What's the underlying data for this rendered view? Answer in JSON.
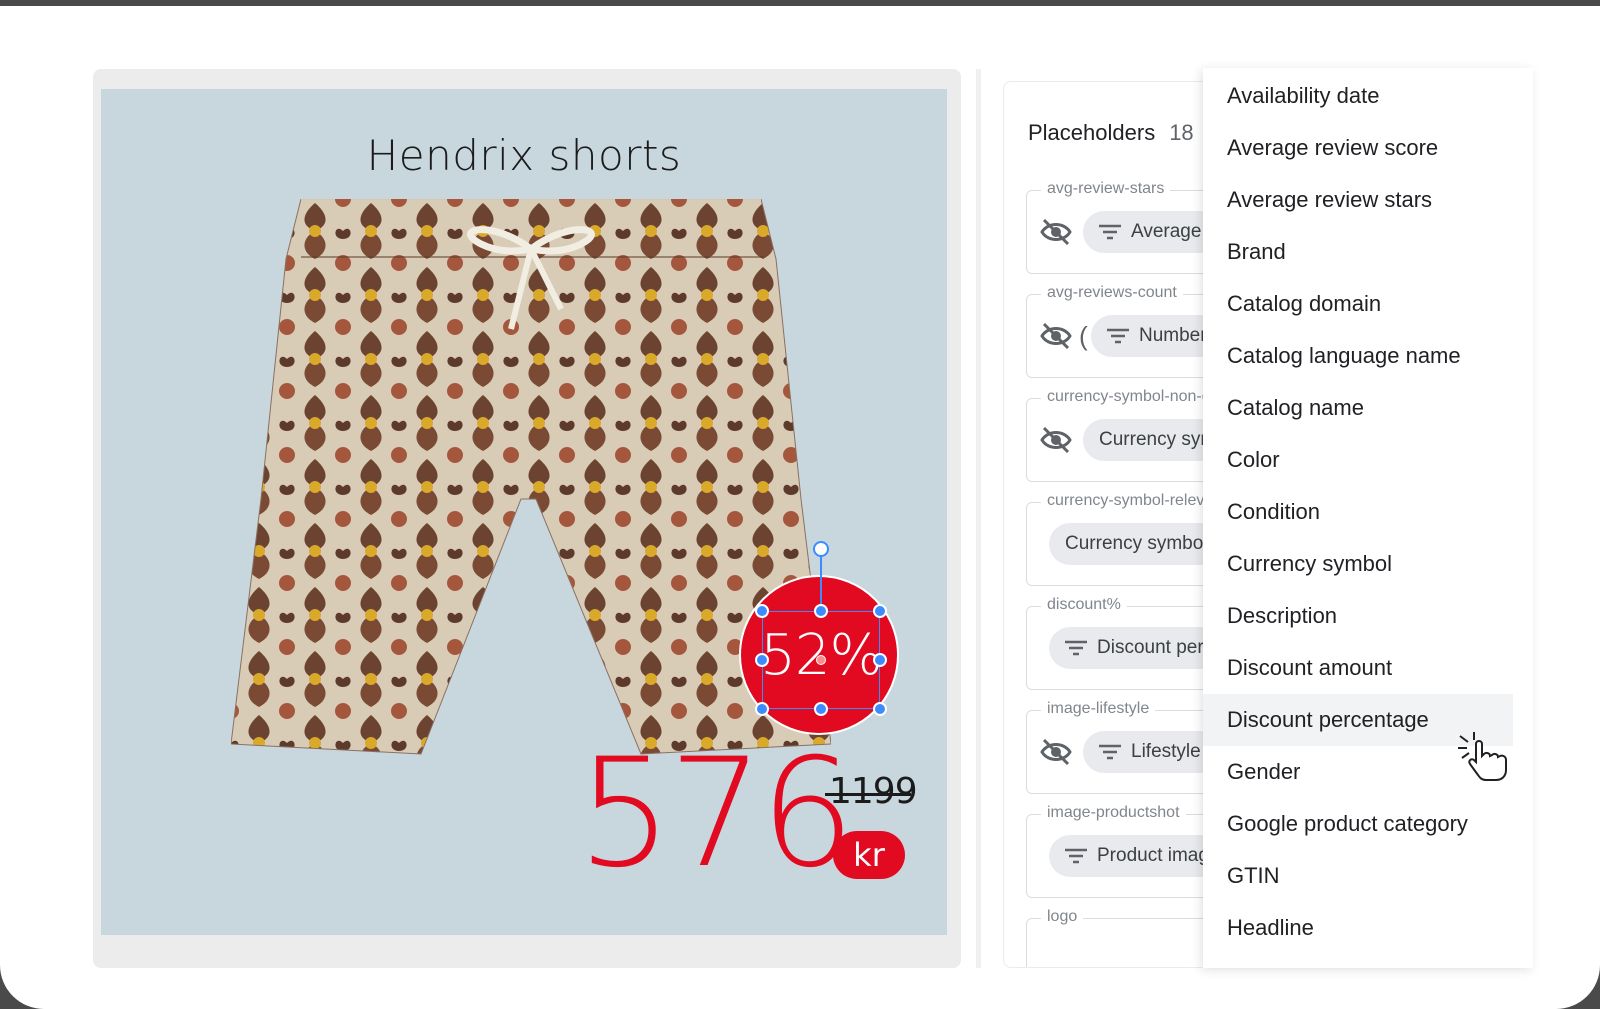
{
  "artboard": {
    "title": "Hendrix shorts",
    "discount": "52%",
    "price": "576",
    "old_price": "1199",
    "currency": "kr",
    "accent_color": "#e10a21",
    "background_color": "#c8d6de"
  },
  "placeholders": {
    "header": "Placeholders",
    "count": "18",
    "items": [
      {
        "label": "avg-review-stars",
        "chip": "Average review stars",
        "hidden_icon": "eye-off-icon"
      },
      {
        "label": "avg-reviews-count",
        "chip": "Number of reviews",
        "hidden_icon": "eye-off-icon",
        "prefix": "("
      },
      {
        "label": "currency-symbol-non-discount",
        "chip": "Currency symbol",
        "hidden_icon": "eye-off-icon"
      },
      {
        "label": "currency-symbol-relevant",
        "chip": "Currency symbol"
      },
      {
        "label": "discount%",
        "chip": "Discount percentage"
      },
      {
        "label": "image-lifestyle",
        "chip": "Lifestyle image",
        "hidden_icon": "eye-off-icon"
      },
      {
        "label": "image-productshot",
        "chip": "Product image"
      },
      {
        "label": "logo",
        "chip": ""
      }
    ]
  },
  "menu": {
    "items": [
      "Availability date",
      "Average review score",
      "Average review stars",
      "Brand",
      "Catalog domain",
      "Catalog language name",
      "Catalog name",
      "Color",
      "Condition",
      "Currency symbol",
      "Description",
      "Discount amount",
      "Discount percentage",
      "Gender",
      "Google product category",
      "GTIN",
      "Headline"
    ],
    "hovered_index": 12
  }
}
